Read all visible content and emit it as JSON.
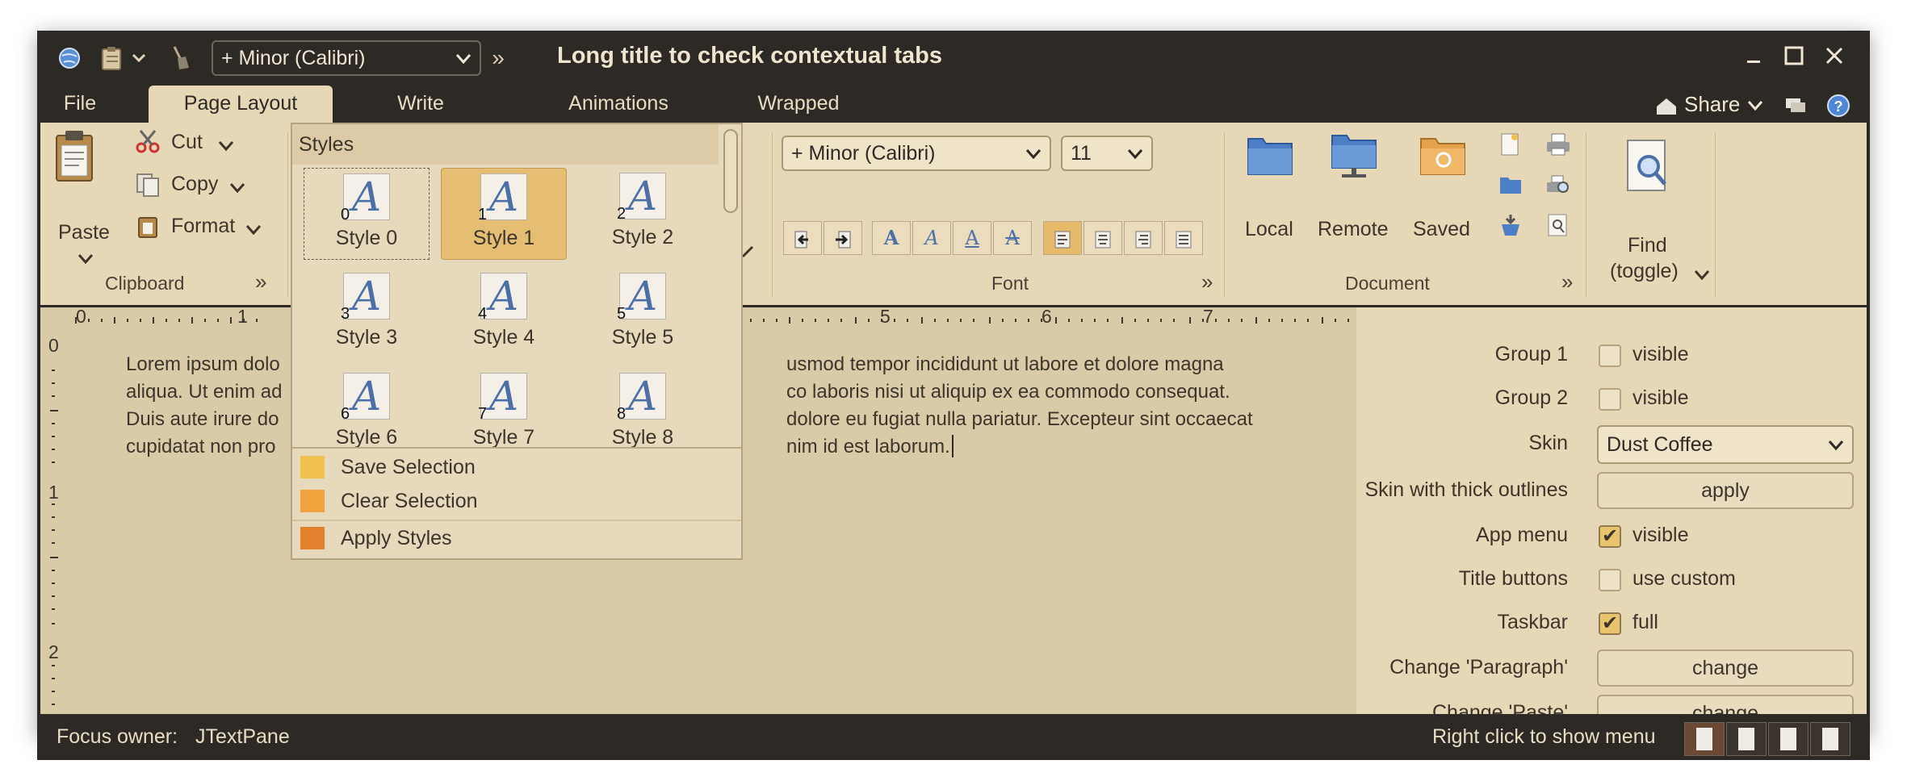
{
  "window": {
    "title": "Long title to check contextual tabs",
    "font_combo": "+ Minor (Calibri)",
    "overflow_glyph": "»",
    "controls": [
      "minimize-icon",
      "maximize-icon",
      "close-icon"
    ]
  },
  "tabs": [
    {
      "label": "File"
    },
    {
      "label": "Page Layout",
      "active": true
    },
    {
      "label": "Write"
    },
    {
      "label": "Animations"
    },
    {
      "label": "Wrapped"
    }
  ],
  "share": {
    "label": "Share"
  },
  "ribbon": {
    "clipboard": {
      "title": "Clipboard",
      "paste": "Paste",
      "cut": "Cut",
      "copy": "Copy",
      "format": "Format"
    },
    "font": {
      "title": "Font",
      "family": "+ Minor (Calibri)",
      "size": "11",
      "style_buttons": [
        "A",
        "A",
        "A",
        "A"
      ]
    },
    "document": {
      "title": "Document",
      "local": "Local",
      "remote": "Remote",
      "saved": "Saved"
    },
    "find": {
      "label_1": "Find",
      "label_2": "(toggle)"
    },
    "expand_glyph": "»"
  },
  "style_popup": {
    "header": "Styles",
    "items": [
      {
        "label": "Style 0",
        "num": "0"
      },
      {
        "label": "Style 1",
        "num": "1",
        "selected": true
      },
      {
        "label": "Style 2",
        "num": "2"
      },
      {
        "label": "Style 3",
        "num": "3"
      },
      {
        "label": "Style 4",
        "num": "4"
      },
      {
        "label": "Style 5",
        "num": "5"
      },
      {
        "label": "Style 6",
        "num": "6"
      },
      {
        "label": "Style 7",
        "num": "7"
      },
      {
        "label": "Style 8",
        "num": "8"
      }
    ],
    "glyph": "A",
    "menu": [
      {
        "label": "Save Selection",
        "color": "#f2c04e"
      },
      {
        "label": "Clear Selection",
        "color": "#f0a23d"
      },
      {
        "label": "Apply Styles",
        "color": "#e5822e"
      }
    ]
  },
  "document": {
    "ruler_numbers": [
      "0",
      "1",
      "5",
      "6",
      "7"
    ],
    "vruler_numbers": [
      "0",
      "1",
      "2"
    ],
    "lines": [
      {
        "left": "Lorem ipsum dolo",
        "right": "usmod tempor incididunt ut labore et dolore magna"
      },
      {
        "left": "aliqua. Ut enim ad",
        "right": "co laboris nisi ut aliquip ex ea commodo consequat."
      },
      {
        "left": "Duis aute irure do",
        "right": "dolore eu fugiat nulla pariatur. Excepteur sint occaecat"
      },
      {
        "left": "cupidatat non pro",
        "right": "nim id est laborum."
      }
    ]
  },
  "panel": {
    "group1": {
      "label": "Group 1",
      "check": "visible",
      "checked": false
    },
    "group2": {
      "label": "Group 2",
      "check": "visible",
      "checked": false
    },
    "skin": {
      "label": "Skin",
      "value": "Dust Coffee"
    },
    "thick": {
      "label": "Skin with thick outlines",
      "button": "apply"
    },
    "appmenu": {
      "label": "App menu",
      "check": "visible",
      "checked": true
    },
    "titlebuttons": {
      "label": "Title buttons",
      "check": "use custom",
      "checked": false
    },
    "taskbar": {
      "label": "Taskbar",
      "check": "full",
      "checked": true
    },
    "paragraph": {
      "label": "Change 'Paragraph'",
      "button": "change"
    },
    "paste": {
      "label": "Change 'Paste'",
      "button": "change"
    }
  },
  "status": {
    "focus_label": "Focus owner:",
    "focus_value": "JTextPane",
    "hint": "Right click to show menu"
  }
}
